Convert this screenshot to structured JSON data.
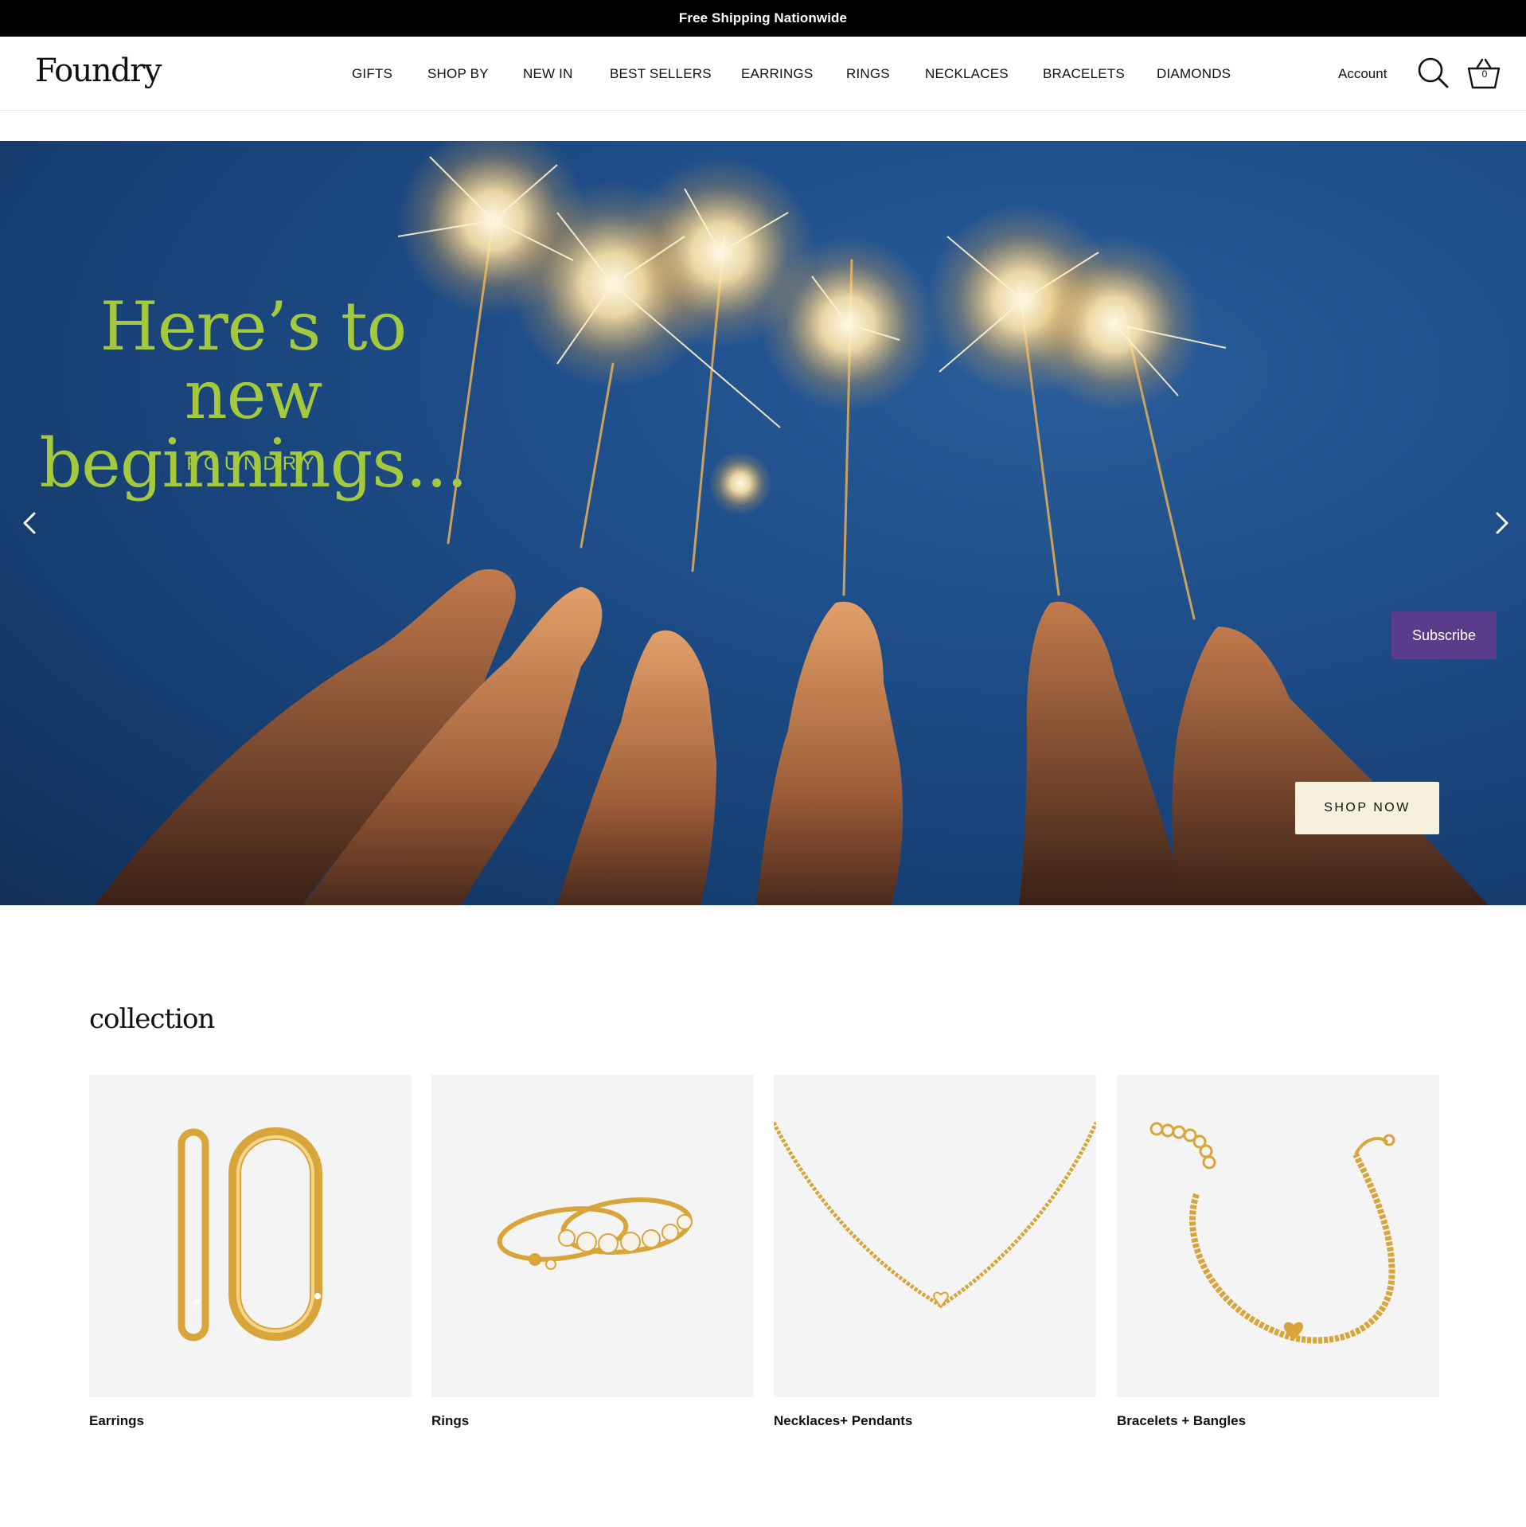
{
  "announcement": {
    "text": "Free Shipping Nationwide"
  },
  "header": {
    "logo": "Foundry",
    "nav": [
      "GIFTS",
      "SHOP BY",
      "NEW IN",
      "BEST SELLERS",
      "EARRINGS",
      "RINGS",
      "NECKLACES",
      "BRACELETS",
      "DIAMONDS"
    ],
    "account_label": "Account",
    "cart_count": "0",
    "icons": {
      "search": "search-icon",
      "cart": "basket-icon"
    }
  },
  "hero": {
    "heading_line1": "Here’s to new",
    "heading_line2": "beginnings...",
    "brand": "FOUNDRY",
    "subscribe_label": "Subscribe",
    "shop_now_label": "SHOP NOW",
    "icons": {
      "prev": "chevron-left-icon",
      "next": "chevron-right-icon"
    }
  },
  "collection": {
    "title": "collection",
    "items": [
      {
        "label": "Earrings"
      },
      {
        "label": "Rings"
      },
      {
        "label": "Necklaces+ Pendants"
      },
      {
        "label": "Bracelets + Bangles"
      }
    ]
  },
  "colors": {
    "announcement_bg": "#000000",
    "hero_sky": "#1e4e8a",
    "hero_text": "#a4c93c",
    "subscribe_bg": "#5a3d8a",
    "shop_now_bg": "#f6f1dc",
    "gold": "#d9a53a",
    "card_bg": "#f4f4f4"
  }
}
